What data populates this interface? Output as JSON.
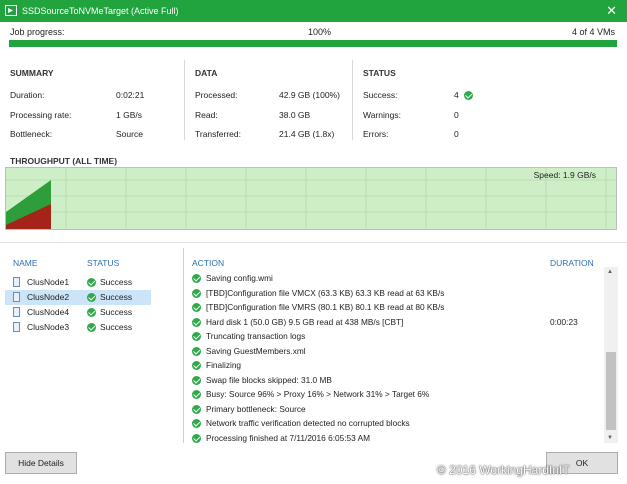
{
  "window": {
    "title": "SSDSourceToNVMeTarget (Active Full)",
    "close_glyph": "✕"
  },
  "job_progress": {
    "label": "Job progress:",
    "percent_text": "100%",
    "fraction": 1.0,
    "vm_count_text": "4 of 4 VMs"
  },
  "summary": {
    "header": "SUMMARY",
    "duration_label": "Duration:",
    "duration_value": "0:02:21",
    "rate_label": "Processing rate:",
    "rate_value": "1 GB/s",
    "bottleneck_label": "Bottleneck:",
    "bottleneck_value": "Source"
  },
  "data": {
    "header": "DATA",
    "processed_label": "Processed:",
    "processed_value": "42.9 GB (100%)",
    "read_label": "Read:",
    "read_value": "38.0 GB",
    "transferred_label": "Transferred:",
    "transferred_value": "21.4 GB (1.8x)"
  },
  "status": {
    "header": "STATUS",
    "success_label": "Success:",
    "success_value": "4",
    "warnings_label": "Warnings:",
    "warnings_value": "0",
    "errors_label": "Errors:",
    "errors_value": "0"
  },
  "throughput": {
    "title": "THROUGHPUT (ALL TIME)",
    "speed_text": "Speed: 1.9 GB/s"
  },
  "vm_list": {
    "name_header": "NAME",
    "status_header": "STATUS",
    "items": [
      {
        "name": "ClusNode1",
        "status": "Success",
        "selected": false
      },
      {
        "name": "ClusNode2",
        "status": "Success",
        "selected": true
      },
      {
        "name": "ClusNode4",
        "status": "Success",
        "selected": false
      },
      {
        "name": "ClusNode3",
        "status": "Success",
        "selected": false
      }
    ]
  },
  "log": {
    "action_header": "ACTION",
    "duration_header": "DURATION",
    "items": [
      {
        "msg": "Saving config.wmi",
        "dur": ""
      },
      {
        "msg": "[TBD]Configuration file VMCX (63.3 KB) 63.3 KB read at 63 KB/s",
        "dur": ""
      },
      {
        "msg": "[TBD]Configuration file VMRS (80.1 KB) 80.1 KB read at 80 KB/s",
        "dur": ""
      },
      {
        "msg": "Hard disk 1 (50.0 GB) 9.5 GB read at 438 MB/s [CBT]",
        "dur": "0:00:23"
      },
      {
        "msg": "Truncating transaction logs",
        "dur": ""
      },
      {
        "msg": "Saving GuestMembers.xml",
        "dur": ""
      },
      {
        "msg": "Finalizing",
        "dur": ""
      },
      {
        "msg": "Swap file blocks skipped: 31.0 MB",
        "dur": ""
      },
      {
        "msg": "Busy: Source 96% > Proxy 16% > Network 31% > Target 6%",
        "dur": ""
      },
      {
        "msg": "Primary bottleneck: Source",
        "dur": ""
      },
      {
        "msg": "Network traffic verification detected no corrupted blocks",
        "dur": ""
      },
      {
        "msg": "Processing finished at 7/11/2016 6:05:53 AM",
        "dur": ""
      }
    ]
  },
  "footer": {
    "hide_details_label": "Hide Details",
    "ok_label": "OK",
    "watermark": "© 2016 WorkingHardInIT"
  },
  "colors": {
    "accent": "#21a33d",
    "chart_bg": "#cdeec7",
    "chart_green": "#2e9e3a",
    "chart_red": "#a5241a",
    "header_blue": "#2b6fb3"
  }
}
